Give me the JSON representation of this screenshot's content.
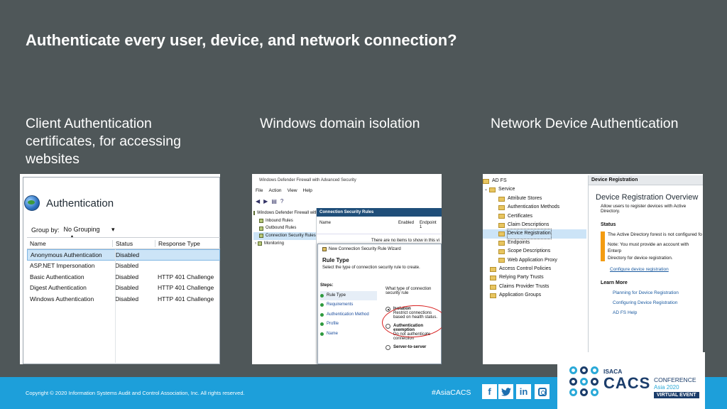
{
  "slide": {
    "title": "Authenticate every user, device, and network connection?"
  },
  "captions": [
    "Client Authentication certificates, for accessing websites",
    "Windows domain isolation",
    "Network Device Authentication"
  ],
  "shot1": {
    "title": "Authentication",
    "group_by_label": "Group by:",
    "group_by_value": "No Grouping",
    "columns": [
      "Name",
      "Status",
      "Response Type"
    ],
    "rows": [
      {
        "name": "Anonymous Authentication",
        "status": "Disabled",
        "response": ""
      },
      {
        "name": "ASP.NET Impersonation",
        "status": "Disabled",
        "response": ""
      },
      {
        "name": "Basic Authentication",
        "status": "Disabled",
        "response": "HTTP 401 Challenge"
      },
      {
        "name": "Digest Authentication",
        "status": "Disabled",
        "response": "HTTP 401 Challenge"
      },
      {
        "name": "Windows Authentication",
        "status": "Disabled",
        "response": "HTTP 401 Challenge"
      }
    ]
  },
  "shot2": {
    "window_title": "Windows Defender Firewall with Advanced Security",
    "menu": [
      "File",
      "Action",
      "View",
      "Help"
    ],
    "tree": [
      "Windows Defender Firewall with",
      "Inbound Rules",
      "Outbound Rules",
      "Connection Security Rules",
      "Monitoring"
    ],
    "pane_header": "Connection Security Rules",
    "columns": [
      "Name",
      "Enabled",
      "Endpoint 1"
    ],
    "empty_text": "There are no items to show in this vi",
    "wizard": {
      "title": "New Connection Security Rule Wizard",
      "heading": "Rule Type",
      "description": "Select the type of connection security rule to create.",
      "steps_label": "Steps:",
      "steps": [
        "Rule Type",
        "Requirements",
        "Authentication Method",
        "Profile",
        "Name"
      ],
      "question": "What type of connection security rule",
      "options": [
        {
          "title": "Isolation",
          "desc": "Restrict connections based on health status."
        },
        {
          "title": "Authentication exemption",
          "desc": "Do not authenticate connection"
        },
        {
          "title": "Server-to-server",
          "desc": ""
        }
      ]
    }
  },
  "shot3": {
    "tree": [
      "AD FS",
      "Service",
      "Attribute Stores",
      "Authentication Methods",
      "Certificates",
      "Claim Descriptions",
      "Device Registration",
      "Endpoints",
      "Scope Descriptions",
      "Web Application Proxy",
      "Access Control Policies",
      "Relying Party Trusts",
      "Claims Provider Trusts",
      "Application Groups"
    ],
    "pane_header": "Device Registration",
    "heading": "Device Registration Overview",
    "subtext": "Allow users to register devices with Active Directory.",
    "status_label": "Status",
    "status_lines": [
      "The Active Directory forest is not configured fo",
      "Note: You must provide an account with Enterp",
      "Directory for device registration."
    ],
    "configure_link": "Configure device registration",
    "learn_more_label": "Learn More",
    "learn_links": [
      "Planning for Device Registration",
      "Configuring Device Registration",
      "AD FS Help"
    ]
  },
  "footer": {
    "copyright": "Copyright © 2020 Information Systems Audit and Control Association, Inc. All rights reserved.",
    "hashtag": "#AsiaCACS",
    "social_icons": [
      "facebook-icon",
      "twitter-icon",
      "linkedin-icon",
      "instagram-icon"
    ],
    "logo": {
      "isaca": "ISACA",
      "cacs": "CACS",
      "conference": "CONFERENCE",
      "edition": "Asia 2020",
      "badge": "VIRTUAL EVENT"
    }
  },
  "colors": {
    "background": "#4f5759",
    "footer_bar": "#1d9fda",
    "title_text": "#ffffff",
    "brand_dark": "#1b3d6b",
    "brand_light": "#2aa9d8"
  }
}
